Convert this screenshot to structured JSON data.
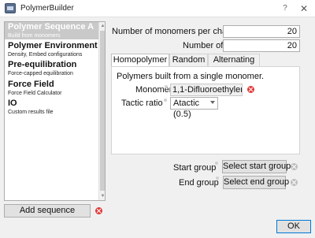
{
  "window": {
    "title": "PolymerBuilder",
    "help_glyph": "?",
    "close_glyph": "✕"
  },
  "sequence_list": {
    "items": [
      {
        "title": "Polymer Sequence A",
        "subtitle": "Build from monomers"
      },
      {
        "title": "Polymer Environment",
        "subtitle": "Density, Embed configurations"
      },
      {
        "title": "Pre-equilibration",
        "subtitle": "Force-capped equilibration"
      },
      {
        "title": "Force Field",
        "subtitle": "Force Field Calculator"
      },
      {
        "title": "IO",
        "subtitle": "Custom results file"
      }
    ],
    "add_label": "Add sequence"
  },
  "chain_settings": {
    "monomers_label": "Number of monomers per chain",
    "monomers_value": "20",
    "chains_label": "Number of chains",
    "chains_value": "20"
  },
  "tabs": {
    "items": [
      {
        "label": "Homopolymer"
      },
      {
        "label": "Random"
      },
      {
        "label": "Alternating"
      }
    ],
    "active": "Homopolymer"
  },
  "homopolymer": {
    "description": "Polymers built from a single monomer.",
    "monomer_label": "Monomer",
    "monomer_value": "1,1-Difluoroethylene",
    "tactic_label": "Tactic ratio",
    "tactic_value": "Atactic (0.5)"
  },
  "groups": {
    "start_label": "Start group",
    "start_button": "Select start group",
    "end_label": "End group",
    "end_button": "Select end group"
  },
  "ok_label": "OK"
}
